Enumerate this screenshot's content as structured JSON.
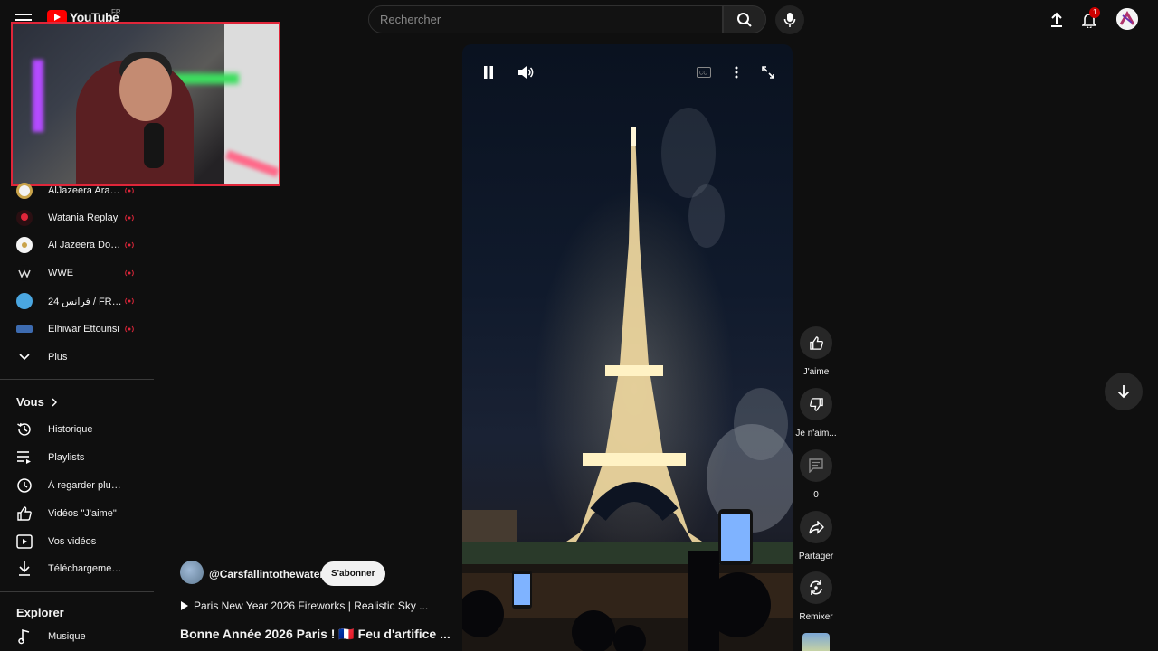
{
  "header": {
    "logo_text": "YouTube",
    "logo_country": "FR",
    "search_placeholder": "Rechercher",
    "notification_count": "1"
  },
  "sidebar": {
    "subscriptions": [
      {
        "label": "AlJazeera Arabic...",
        "avatar_color": "#f2f2f2"
      },
      {
        "label": "Watania Replay",
        "avatar_color": "#2a0f12"
      },
      {
        "label": "Al Jazeera Docu...",
        "avatar_color": "#f5f5f5"
      },
      {
        "label": "WWE",
        "avatar_color": "#0f0f0f"
      },
      {
        "label": "24 فرانس / FRANC...",
        "avatar_color": "#4aa6e0"
      },
      {
        "label": "Elhiwar Ettounsi",
        "avatar_color": "#3d6bb0"
      }
    ],
    "more_label": "Plus",
    "you_section": "Vous",
    "you_items": [
      {
        "label": "Historique",
        "icon": "history-icon"
      },
      {
        "label": "Playlists",
        "icon": "playlist-icon"
      },
      {
        "label": "À regarder plus tard",
        "icon": "clock-icon"
      },
      {
        "label": "Vidéos \"J'aime\"",
        "icon": "thumbs-up-icon"
      },
      {
        "label": "Vos vidéos",
        "icon": "video-icon"
      },
      {
        "label": "Téléchargements",
        "icon": "download-icon"
      }
    ],
    "explore_section": "Explorer",
    "explore_items": [
      {
        "label": "Musique",
        "icon": "music-icon"
      }
    ]
  },
  "short": {
    "channel": "@Carsfallintothewater",
    "subscribe_label": "S'abonner",
    "music": "Paris New Year 2026 Fireworks | Realistic Sky ...",
    "title": "Bonne Année 2026 Paris ! 🇫🇷 Feu d'artifice ..."
  },
  "actions": {
    "like_label": "J'aime",
    "dislike_label": "Je n'aim...",
    "comments_count": "0",
    "share_label": "Partager",
    "remix_label": "Remixer"
  },
  "colors": {
    "accent_red": "#ff0000",
    "live_red": "#e0263a",
    "background": "#0f0f0f"
  }
}
